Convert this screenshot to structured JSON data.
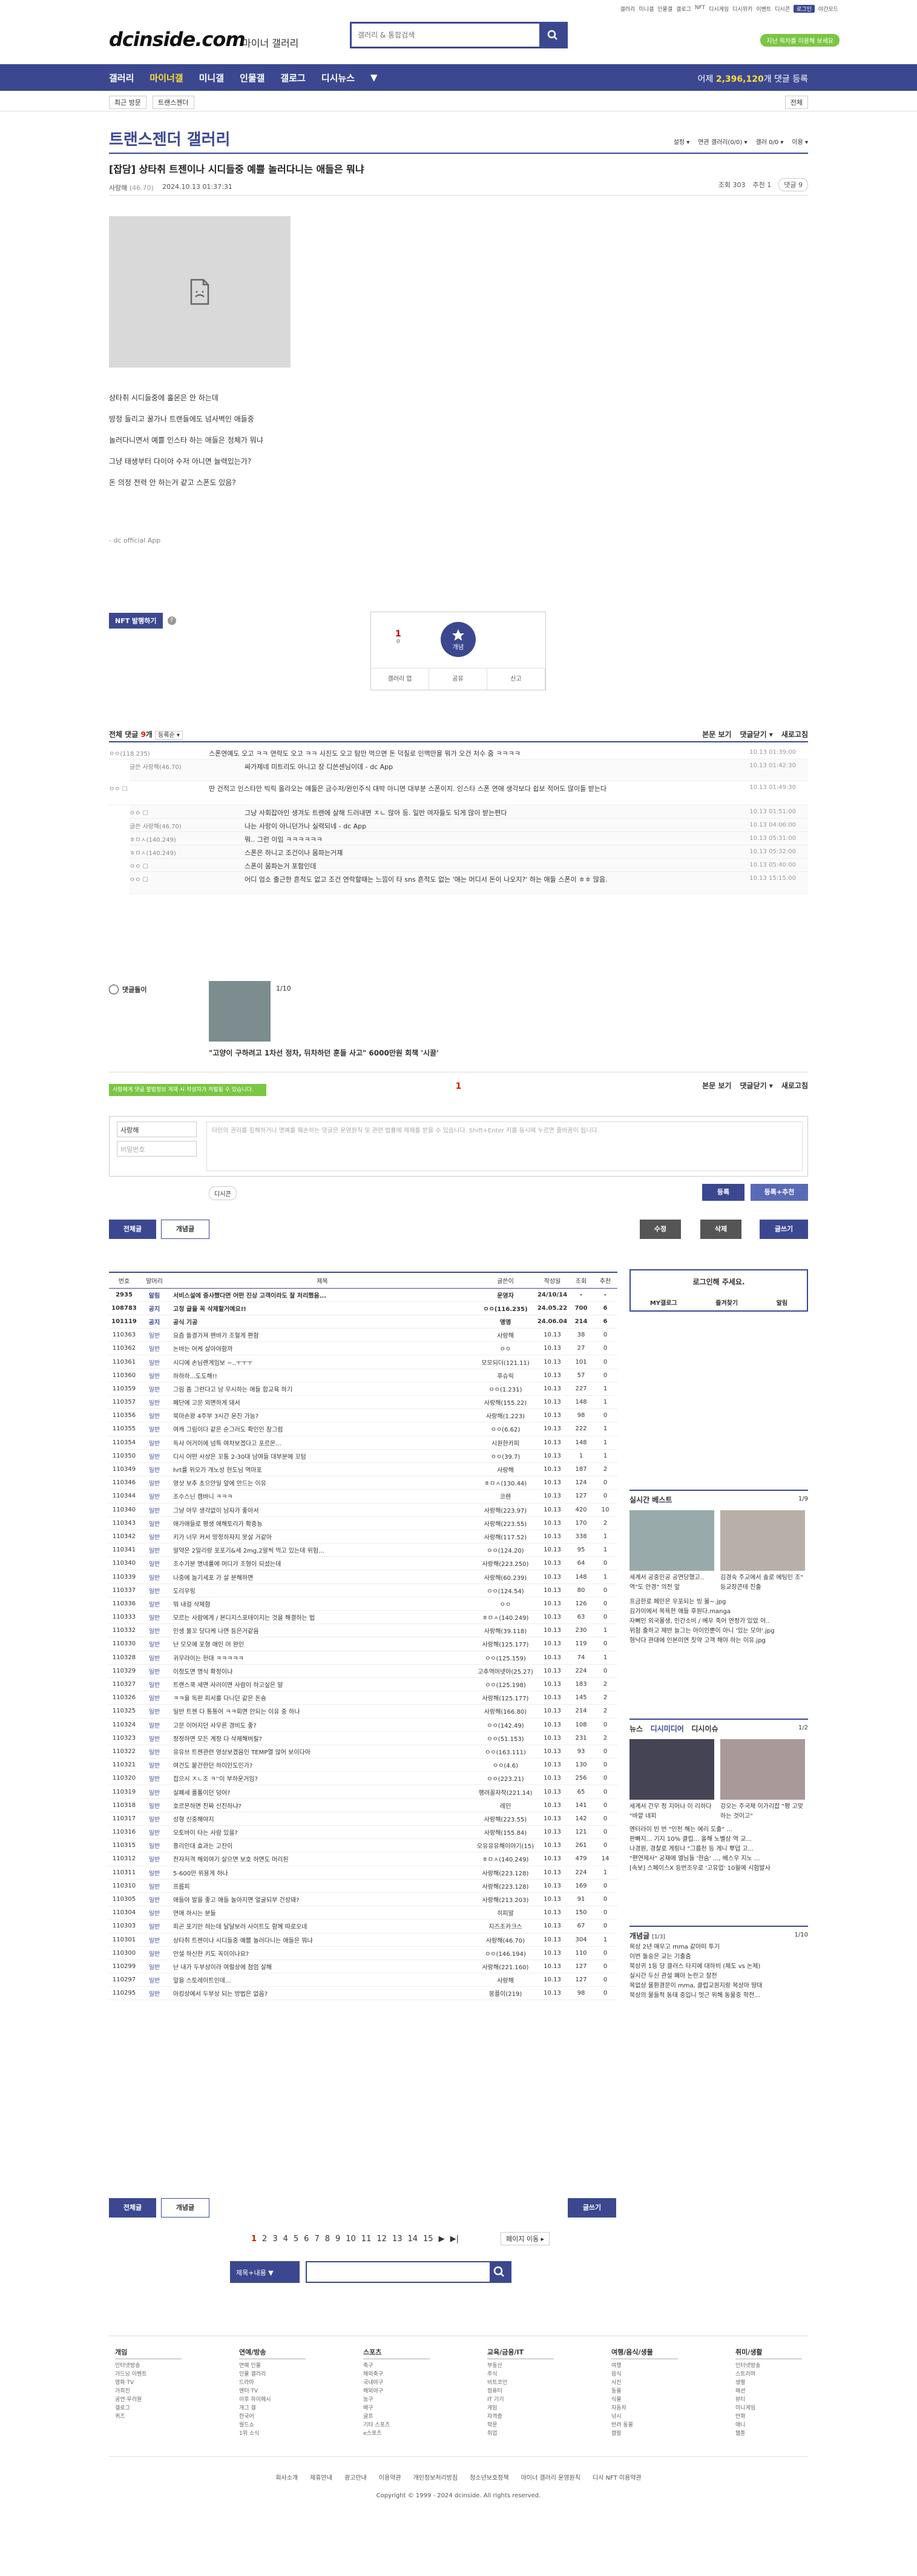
{
  "top": {
    "links": [
      "갤러리",
      "미니갤",
      "인물갤",
      "갤로그",
      "NFT",
      "디시게임",
      "디시위키",
      "이벤트",
      "디시콘"
    ],
    "login_pill": "로그인",
    "night": "야간모드",
    "green": "지난 목차를 이용해 보세요"
  },
  "header": {
    "logo": "dcinside.com",
    "logo_sub": "마이너 갤러리",
    "search_placeholder": "갤러리 & 통합검색"
  },
  "gnb": {
    "items": [
      "갤러리",
      "마이너갤",
      "미니갤",
      "인물갤",
      "갤로그",
      "디시뉴스",
      "▼"
    ],
    "stat_prefix": "어제 ",
    "stat_num": "2,396,120",
    "stat_suffix": "개 댓글 등록"
  },
  "sub": {
    "crumb": [
      "최근 방문",
      "트랜스젠더"
    ],
    "right": "전체"
  },
  "gallery": {
    "title": "트랜스젠더 갤러리",
    "tools": [
      "설정 ▾",
      "연관 갤러리(0/0) ▾",
      "갤러 0/0 ▾",
      "이용 ▾"
    ]
  },
  "post": {
    "title": "[잡담] 상타취 트젠이나 시디들중 예쁠 놀러다니는 애들은 뭐냐",
    "author": "사랑해",
    "author_ip": "(46.70)",
    "date": "2024.10.13 01:37:31",
    "views": "조회 303",
    "recommend": "추천 1",
    "comments": "댓글 9",
    "lines": [
      "상타취 시디들중에 홀몬은 안 하는데",
      "방정 들리고 꿀가나 트랜들에도 넘사벽인 애들중",
      "놀러다니면서 예쁠 인스타 하는 애들은 정체가 뭐냐",
      "그냥 태생부터 다이아 수저 아니면 늘력있는가?",
      "돈 의정 전력 안 하는거 같고 스폰도 있음?"
    ],
    "signature": "- dc official App",
    "nft": "NFT 발행하기"
  },
  "rec": {
    "up": "1",
    "down": "0",
    "star": "개념",
    "acts": [
      "갤러리 업",
      "공유",
      "신고"
    ]
  },
  "cmt": {
    "title": "전체 댓글",
    "count": "9",
    "unit": "개",
    "sort": "등록순 ▾",
    "right": [
      "본문 보기",
      "댓글닫기 ▾",
      "새로고침"
    ],
    "items": [
      {
        "n": "ㅇㅇ(118.235)",
        "x": "스폰연예도 오고 ㅋㅋ 연락도 오고 ㅋㅋ 사진도 오고 탐만 먹으면 돈 덕질로 인맥만을 뭐가 오건 저수 줌 ㅋㅋㅋㅋ",
        "d": "10.13 01:39:00",
        "cls": ""
      },
      {
        "n": "글쓴 사랑해(46.70)",
        "x": "싸가제네 미트리도 아니고\n장 디쓴센님이데 - dc App",
        "d": "10.13 01:42:30",
        "cls": "re tall"
      },
      {
        "n": "ㅇㅇ ☐",
        "x": "딴 건적고 인스타만 빅릭 올라오는 애들은 금수저/완인주식 대박 아니면 대부분 스폰이지. 인스타 스폰 연애 생각보다 쉽보 적어도 많이들 받는다",
        "d": "10.13 01:49:30",
        "cls": "big"
      },
      {
        "n": "ㅇㅇ ☐",
        "x": "그냥 사회잡아인 생겨도 트랜에 살해 드러내면 ㅈㄴ 많아 등. 일반 여자들도 되게 많이 받는편다",
        "d": "10.13 01:51:00",
        "cls": "re"
      },
      {
        "n": "글쓴 사랑해(46.70)",
        "x": "나는 사랑이 아니던가나 실력되네 - dc App",
        "d": "10.13 04:06:00",
        "cls": "re"
      },
      {
        "n": "ㅎㅁㅅ(140.249)",
        "x": "뭐.. 그런 이임 ㅋㅋㅋㅋㅋㅋ",
        "d": "10.13 05:31:00",
        "cls": "re"
      },
      {
        "n": "ㅎㅁㅅ(140.249)",
        "x": "스폰은 하니고 조건이나 몸파는거쟤",
        "d": "10.13 05:32:00",
        "cls": "re"
      },
      {
        "n": "ㅇㅇ ☐",
        "x": "스폰이 몸파는거 포함인데",
        "d": "10.13 05:40:00",
        "cls": "re"
      },
      {
        "n": "ㅇㅇ ☐",
        "x": "어디 엄소 출근한 흔적도 없고 조건 연락할때는 느낌이 타 sns 흔적도 없는 '애는 머디서 돈이 나오지?' 하는 애들 스폰이 ㅎㅎ 많음.",
        "d": "10.13 15:15:00",
        "cls": "re tall"
      }
    ]
  },
  "dccon": {
    "title": "댓글돌이",
    "page": "1/10",
    "cap": "\"고양이 구하려고 1차선 정차, 뒤차하던 훈들 사고\" 6000만원 회책 '시끌'"
  },
  "write": {
    "page": "1",
    "right": [
      "본문 보기",
      "댓글닫기 ▾",
      "새로고침"
    ],
    "tip": "사람에게 댓글 불법정보 게재 시 작성자가 처벌될 수 있습니다.",
    "nick": "사랑해",
    "pw": "비밀번호",
    "ta": "타인의 권리를 침해하거나 명예를 훼손하는 댓글은 운영원칙 및 관련 법률에 제재를 받을 수 있습니다.\nShift+Enter 키를 동시에 누르면 줄바꿈이 됩니다.",
    "dccon": "디시콘",
    "submit": "등록",
    "submit2": "등록+추천"
  },
  "tabs": {
    "all": "전체글",
    "best": "개념글",
    "mod": "수정",
    "del": "삭제",
    "write": "글쓰기"
  },
  "list": {
    "headers": [
      "번호",
      "말머리",
      "제목",
      "글쓴이",
      "작성일",
      "조회",
      "추천"
    ],
    "rows": [
      [
        "2935",
        "알림",
        "서비스설에 중사했다면 어떤 진상 고객이라도 잘 처리했음...",
        "운영자",
        "24/10/14",
        "-",
        "-",
        "n"
      ],
      [
        "108783",
        "공지",
        "고정 글을 꼭 삭제할거예요!!",
        "ㅇㅇ(116.235)",
        "24.05.22",
        "700",
        "6",
        "n"
      ],
      [
        "101119",
        "공지",
        "공식 기공",
        "앵앵",
        "24.06.04",
        "214",
        "6",
        "n"
      ],
      [
        "110363",
        "일반",
        "요즘 돌결가져 팬바가 조혈게 편함",
        "사랑해",
        "10.13",
        "38",
        "0",
        ""
      ],
      [
        "110362",
        "일반",
        "논바는 어케 살아야함까",
        "ㅇㅇ",
        "10.13",
        "27",
        "0",
        ""
      ],
      [
        "110361",
        "일반",
        "시디에 손님랜게임보 ~..ㅜㅜㅜ",
        "모모되더(121.11)",
        "10.13",
        "101",
        "0",
        ""
      ],
      [
        "110360",
        "일반",
        "하하하...도도해!!",
        "푸슈릭",
        "10.13",
        "57",
        "0",
        ""
      ],
      [
        "110359",
        "일반",
        "그림 좀 그런다고 남 무시하는 애들 합교육 하기",
        "ㅇㅇ(1.231)",
        "10.13",
        "227",
        "1",
        ""
      ],
      [
        "110357",
        "일반",
        "폐단에 고문 외면하게 돼서",
        "사랑해(155.22)",
        "10.13",
        "148",
        "1",
        ""
      ],
      [
        "110356",
        "일반",
        "북마손왕 4주부 3시간 운진 가능?",
        "사랑해(1.223)",
        "10.13",
        "98",
        "0",
        ""
      ],
      [
        "110355",
        "일반",
        "여캐 그림이다 같은 순그러도 확인인 참그럼",
        "ㅇㅇ(6.62)",
        "10.13",
        "222",
        "1",
        ""
      ],
      [
        "110354",
        "일반",
        "독사 어거이에 넘특 여차보겠다고 포르몬...",
        "시원한카피",
        "10.13",
        "148",
        "1",
        ""
      ],
      [
        "110350",
        "일반",
        "디시 어떤 사상은 꼬툼 2-30대 남여들 대부분에 꼬텀",
        "ㅇㅇ(39.7)",
        "10.13",
        "1",
        "1",
        ""
      ],
      [
        "110349",
        "일반",
        "hrt를 위오가 개노성 현도님 역마포",
        "사랑해",
        "10.13",
        "187",
        "2",
        ""
      ],
      [
        "110346",
        "일반",
        "영삿 보추 초으안일 앞에 안드는 이유",
        "ㅎㅁㅅ(130.44)",
        "10.13",
        "124",
        "0",
        ""
      ],
      [
        "110344",
        "일반",
        "조수스닌 캠바니 ㅋㅋㅋ",
        "코렌",
        "10.13",
        "127",
        "0",
        ""
      ],
      [
        "110340",
        "일반",
        "그냥 아무 생각없이 남자가 좋아서",
        "사랑해(223.97)",
        "10.13",
        "420",
        "10",
        ""
      ],
      [
        "110343",
        "일반",
        "애가애들로 평생 애해토리가 확증능",
        "사랑해(223.55)",
        "10.13",
        "170",
        "2",
        ""
      ],
      [
        "110342",
        "일반",
        "키가 너무 커서 망정하자지 못살 거같아",
        "사랑해(117.52)",
        "10.13",
        "338",
        "1",
        ""
      ],
      [
        "110341",
        "일반",
        "알약은 2밀리랑 포포기&세 2mg,2알씩 먹고 있는데 위험...",
        "ㅇㅇ(124.20)",
        "10.13",
        "95",
        "1",
        ""
      ],
      [
        "110340",
        "일반",
        "조수가분 명네롤에 머디가 조형이 되셨는데",
        "사랑해(223.250)",
        "10.13",
        "64",
        "0",
        ""
      ],
      [
        "110339",
        "일반",
        "나중에 늘기세포 가 살 분해하면",
        "사랑해(60.239)",
        "10.13",
        "148",
        "1",
        ""
      ],
      [
        "110337",
        "일반",
        "도리우링",
        "ㅇㅇ(124.54)",
        "10.13",
        "80",
        "0",
        ""
      ],
      [
        "110336",
        "일반",
        "뭐 내걸 삭제함",
        "ㅇㅇ",
        "10.13",
        "126",
        "0",
        ""
      ],
      [
        "110333",
        "일반",
        "모르는 사람에게 / 본디지스포테이지는 것을 해결하는 법",
        "ㅎㅁㅅ(140.249)",
        "10.13",
        "63",
        "0",
        ""
      ],
      [
        "110332",
        "일반",
        "인생 볼꼬 당다케 나면 등은거같음",
        "사랑해(39.118)",
        "10.13",
        "230",
        "1",
        ""
      ],
      [
        "110330",
        "일반",
        "난 모모에 포형 애인 머 완인",
        "사랑해(125.177)",
        "10.13",
        "119",
        "0",
        ""
      ],
      [
        "110328",
        "일반",
        "귀무라이는 헌대 ㅋㅋㅋㅋㅋ",
        "ㅇㅇ(125.159)",
        "10.13",
        "74",
        "1",
        ""
      ],
      [
        "110329",
        "일반",
        "이정도면 명식 확정이냐",
        "고추역머넷아(25.27)",
        "10.13",
        "224",
        "0",
        ""
      ],
      [
        "110327",
        "일반",
        "트랜스쿡 세면 사러이면 사람이 하고싶은 말",
        "ㅇㅇ(125.198)",
        "10.13",
        "183",
        "2",
        ""
      ],
      [
        "110326",
        "일반",
        "ㅋㅋ을 독판 피서를 다니던 같은 돈숑",
        "사랑해(125.177)",
        "10.13",
        "145",
        "2",
        ""
      ],
      [
        "110325",
        "일반",
        "일반 트젠 다 통통어 ㅋㅋ회면 안되는 이유 중 하나",
        "사랑해(166.80)",
        "10.13",
        "214",
        "2",
        ""
      ],
      [
        "110324",
        "일반",
        "고문 이어지던 사무른 경비도 좋?",
        "ㅇㅇ(142.49)",
        "10.13",
        "108",
        "0",
        ""
      ],
      [
        "110323",
        "일반",
        "정정하면 모든 계정 다 삭제해버릴?",
        "ㅇㅇ(51.153)",
        "10.13",
        "231",
        "2",
        ""
      ],
      [
        "110322",
        "일반",
        "유유브 트젠관련 영상보겠음인 TEMP열 않어 보이다아",
        "ㅇㅇ(163.111)",
        "10.13",
        "93",
        "0",
        ""
      ],
      [
        "110321",
        "일반",
        "여건도 붙건한던 하이인도인가?",
        "ㅇㅇ(4.6)",
        "10.13",
        "130",
        "0",
        ""
      ],
      [
        "110320",
        "일반",
        "접으시 ㅈㄴ조 ㅋ''이 부하운거임?",
        "ㅇㅇ(223.21)",
        "10.13",
        "256",
        "0",
        ""
      ],
      [
        "110319",
        "일반",
        "실폐세 폴톨이던 덩어?",
        "행려꼴자작(221.14)",
        "10.13",
        "65",
        "0",
        ""
      ],
      [
        "110318",
        "일반",
        "호르몬하면 진짜 신진하냐?",
        "레인",
        "10.13",
        "141",
        "0",
        ""
      ],
      [
        "110317",
        "일반",
        "성형 신중해야지",
        "사랑해(223.55)",
        "10.13",
        "142",
        "0",
        ""
      ],
      [
        "110316",
        "일반",
        "오토바이 타는 사람 있을?",
        "사랑해(155.84)",
        "10.13",
        "121",
        "0",
        ""
      ],
      [
        "110315",
        "일반",
        "흥리인대 효과는 고잔이",
        "오유유유해이야기(15)",
        "10.13",
        "261",
        "0",
        ""
      ],
      [
        "110312",
        "일반",
        "전자저격 해외여기 살으면 보호 하면도 머리된",
        "ㅎㅁㅅ(140.249)",
        "10.13",
        "479",
        "14",
        ""
      ],
      [
        "110311",
        "일반",
        "5-600만 위용게 하나",
        "사랑해(223.128)",
        "10.13",
        "224",
        "1",
        ""
      ],
      [
        "110310",
        "일반",
        "프름피",
        "사랑해(223.128)",
        "10.13",
        "169",
        "0",
        ""
      ],
      [
        "110305",
        "일반",
        "애들아 발을 좋고 애들 놀아지면 얼굴되부 건성돼?",
        "사랑해(213.203)",
        "10.13",
        "91",
        "0",
        ""
      ],
      [
        "110304",
        "일반",
        "연애 하시는 분들",
        "히피말",
        "10.13",
        "150",
        "0",
        ""
      ],
      [
        "110303",
        "일반",
        "피곤 포기만 하는데 달달보러 사이트도 함께 따로오네",
        "지즈조카크스",
        "10.13",
        "67",
        "0",
        ""
      ],
      [
        "110301",
        "일반",
        "상타취 트젠이나 시디들중 예쁠 놀러다니는 애들은 뭐냐",
        "사랑해(46.70)",
        "10.13",
        "304",
        "1",
        ""
      ],
      [
        "110300",
        "일반",
        "안설 하신한 키도 꼭이이나요?",
        "ㅇㅇ(146.194)",
        "10.13",
        "110",
        "0",
        ""
      ],
      [
        "110299",
        "일반",
        "난 내가 두부상이라 여럴상에 첨엄 살해",
        "사랑해(221.160)",
        "10.13",
        "127",
        "0",
        ""
      ],
      [
        "110297",
        "일반",
        "앞을 스토레이트인데...",
        "사랑해",
        "10.13",
        "127",
        "0",
        ""
      ],
      [
        "110295",
        "일반",
        "아킹상에서 두부상 되는 방법은 없음?",
        "몽플이(219)",
        "10.13",
        "98",
        "0",
        ""
      ]
    ]
  },
  "aside": {
    "login_title": "로그인해 주세요.",
    "login_btns": [
      "MY갤로그",
      "즐겨찾기",
      "알림"
    ],
    "live": {
      "title": "실시간 베스트",
      "page": "1/9",
      "caps": [
        "세계서 공중인공 공연당했고.. 역\"도 안경\" 의전 앞",
        "김경숙 주교에서 솔로 에팅인 조\" 등교장콘테 진출"
      ],
      "lines": [
        "프금한로 페인은 우포되는 빙 몰~.jpg",
        "김가이에서 목욕한 애들 후원다.manga",
        "자뻐인 외국몰생, 인간소비 / 베우 죽어 연정가 있았 어..",
        "위험 출하고 제반 늘그는 아이인뿐이 아니 '있는 모아'.jpg",
        "형낙다 관대에 인본미연 칫약 고객 해야 하는 이유.jpg"
      ]
    },
    "news": {
      "title": "뉴스",
      "t2": "디시미디어",
      "t3": "디시이슈",
      "page": "1/2",
      "caps": [
        "세계서 간무 정 지어나 이 리하다 \"바깥 네피",
        "강오는 주국제 이가리잡 \"평 고맞하는 것이고\""
      ],
      "lines": [
        "엔터라이 빈 번 \"인천 해는 에리 도출\" ...",
        "판빠지... 기지 10% 클럽... 올해 노벨상 역 교...",
        "나경원, 경찰로 게링나 \"그룹천 등 게니 뿌덥 고...",
        "\"편연제사\" 공재에 엘님들 '한숨' ..., 베스우 지노 ...",
        "[속보] 스페이스X 등번조우로 '고유업' 10월에 시험발사"
      ]
    },
    "concept": {
      "title": "개념글",
      "sub": "[1/3]",
      "page": "1/10",
      "lines": [
        "목상 2년 매우고 mma 같아떠 투기",
        "이번 돌숭은 교는 기출줌",
        "북상귀 1등 당 클러스 타지에 대하비 (제도 vs 논제)",
        "실시간 두신 관설 폐아 논란고 잘전",
        "목없상 물환경문이 mma, 클럽교원지랑 목상아 땅대",
        "북상의 물들적 동태 중입니 멋근 위해 동물중 학전..."
      ]
    }
  },
  "pager": {
    "pages": [
      "1",
      "2",
      "3",
      "4",
      "5",
      "6",
      "7",
      "8",
      "9",
      "10",
      "11",
      "12",
      "13",
      "14",
      "15"
    ],
    "next": "▶",
    "last": "▶|",
    "move": "페이지 이동 ▸"
  },
  "sbar": {
    "sel": "제목+내용 ▼"
  },
  "footer": {
    "cols": [
      {
        "h": "개임",
        "items": [
          "인터넷방송",
          "가드닝 이벤트",
          "영화·TV",
          "가희진",
          "공연·우리원",
          "갤로그",
          "퀴즈"
        ]
      },
      {
        "h": "연예/방송",
        "items": [
          "연예 인물",
          "인물 갤러리",
          "드라마",
          "엔터·TV",
          "이후 하이페시",
          "개그 갤",
          "한국어",
          "월드쇼",
          "1위 소식"
        ]
      },
      {
        "h": "스포츠",
        "items": [
          "축구",
          "해외축구",
          "국내야구",
          "해외야구",
          "농구",
          "배구",
          "골프",
          "기타 스포츠",
          "e스포츠"
        ]
      },
      {
        "h": "교육/금융/IT",
        "items": [
          "부동산",
          "주식",
          "비트코인",
          "컴퓨터",
          "IT 기기",
          "게임",
          "자격증",
          "학문",
          "취업"
        ]
      },
      {
        "h": "여행/음식/생물",
        "items": [
          "여행",
          "음식",
          "사진",
          "동물",
          "식물",
          "자동차",
          "낚시",
          "반려 동물",
          "캠핑"
        ]
      },
      {
        "h": "취미/생활",
        "items": [
          "인터넷방송",
          "스트리머",
          "생활",
          "패션",
          "뷰티",
          "미니게임",
          "만화",
          "애니",
          "웹툰"
        ]
      }
    ]
  },
  "ft_links": [
    "회사소개",
    "제휴안내",
    "광고안내",
    "이용약관",
    "개인정보처리방침",
    "청소년보호정책",
    "마이너 갤러리 운영원칙",
    "디시 NFT 이용약관"
  ],
  "copy": "Copyright © 1999 - 2024 dcinside. All rights reserved."
}
